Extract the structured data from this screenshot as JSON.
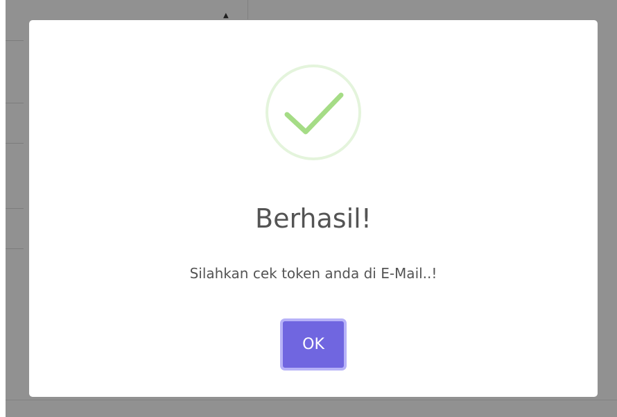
{
  "dialog": {
    "title": "Berhasil!",
    "message": "Silahkan cek token anda di E-Mail..!",
    "confirm_label": "OK",
    "icon": "check-circle-icon"
  },
  "colors": {
    "confirm_button": "#7066e0",
    "confirm_focus_ring": "#b7b2f8",
    "success_green": "#a5dc86",
    "success_ring": "#e4f4dc",
    "text": "#545454"
  }
}
